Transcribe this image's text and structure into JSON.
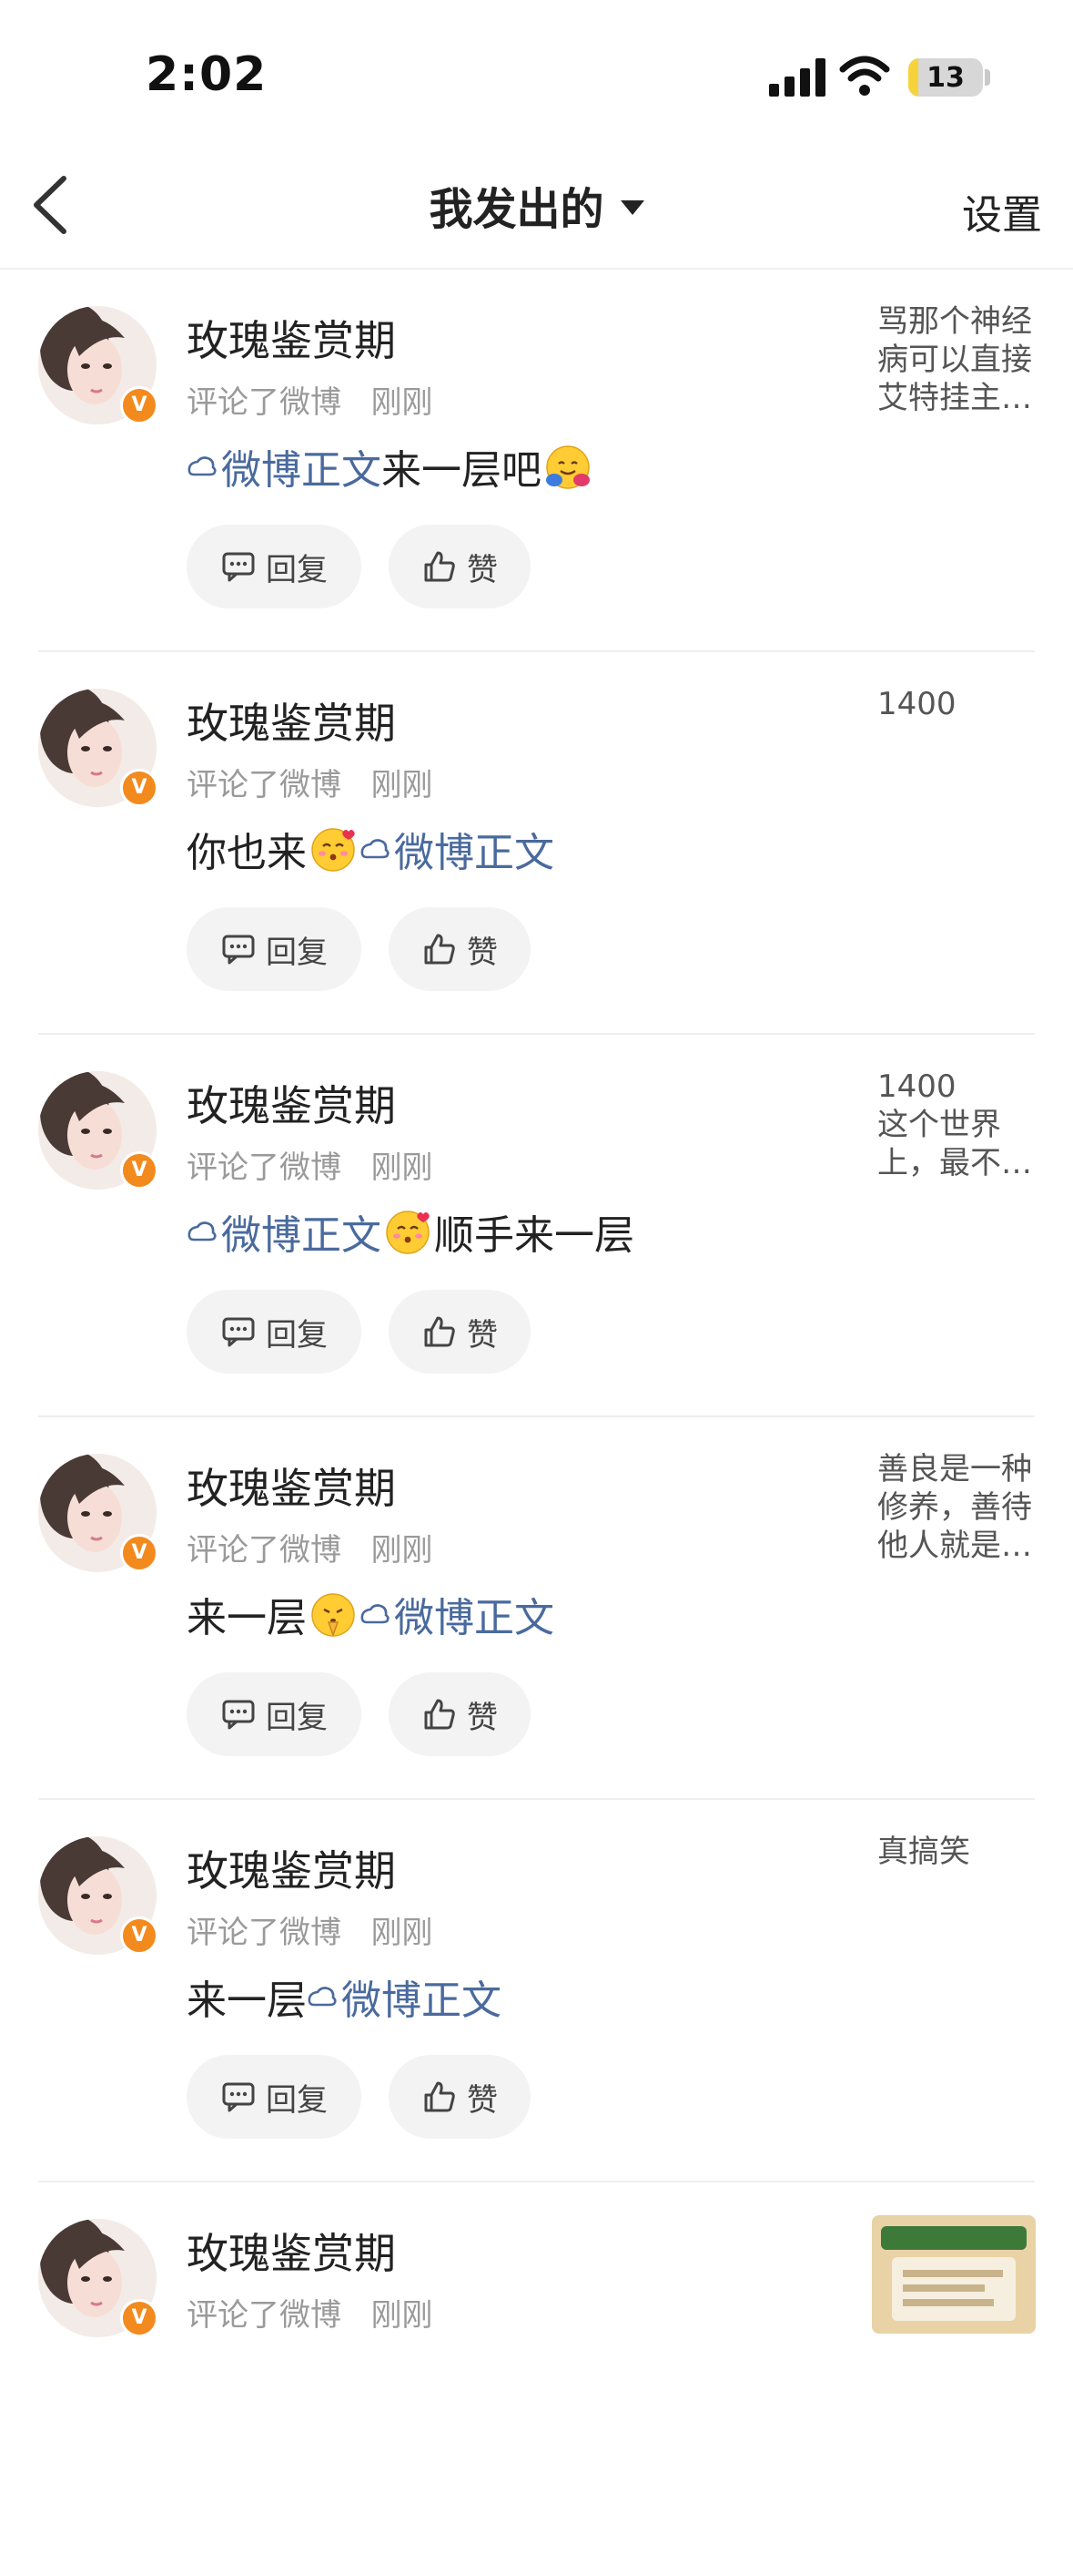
{
  "status_bar": {
    "time": "2:02",
    "battery": "13",
    "battery_level": 0.13
  },
  "nav": {
    "title": "我发出的",
    "settings": "设置"
  },
  "colors": {
    "link": "#4a6a9e",
    "badge": "#f28a1e",
    "battery": "#f6d33a"
  },
  "items": [
    {
      "username": "玫瑰鉴赏期",
      "action": "评论了微博",
      "time": "刚刚",
      "c1": "",
      "link": "微博正文",
      "c2": "来一层吧",
      "emoji_after": "hug-face-emoji",
      "preview": "骂那个神经病可以直接艾特挂主…",
      "reply": "回复",
      "like": "赞"
    },
    {
      "username": "玫瑰鉴赏期",
      "action": "评论了微博",
      "time": "刚刚",
      "c1": "你也来",
      "emoji_mid": "heart-kiss-face-emoji",
      "link": "微博正文",
      "c2": "",
      "preview": "1400",
      "reply": "回复",
      "like": "赞"
    },
    {
      "username": "玫瑰鉴赏期",
      "action": "评论了微博",
      "time": "刚刚",
      "c1": "",
      "link": "微博正文",
      "emoji_after_link": "heart-kiss-face-emoji",
      "c2": "顺手来一层",
      "preview": "1400\n这个世界上，最不…",
      "reply": "回复",
      "like": "赞"
    },
    {
      "username": "玫瑰鉴赏期",
      "action": "评论了微博",
      "time": "刚刚",
      "c1": "来一层",
      "emoji_mid": "praying-face-emoji",
      "link": "微博正文",
      "c2": "",
      "preview": "善良是一种修养，善待他人就是…",
      "reply": "回复",
      "like": "赞"
    },
    {
      "username": "玫瑰鉴赏期",
      "action": "评论了微博",
      "time": "刚刚",
      "c1": "来一层",
      "link": "微博正文",
      "c2": "",
      "preview": "真搞笑",
      "reply": "回复",
      "like": "赞"
    },
    {
      "username": "玫瑰鉴赏期",
      "action": "评论了微博",
      "time": "刚刚",
      "c1": "",
      "link": "",
      "c2": "",
      "preview": "",
      "reply": "",
      "like": ""
    }
  ]
}
